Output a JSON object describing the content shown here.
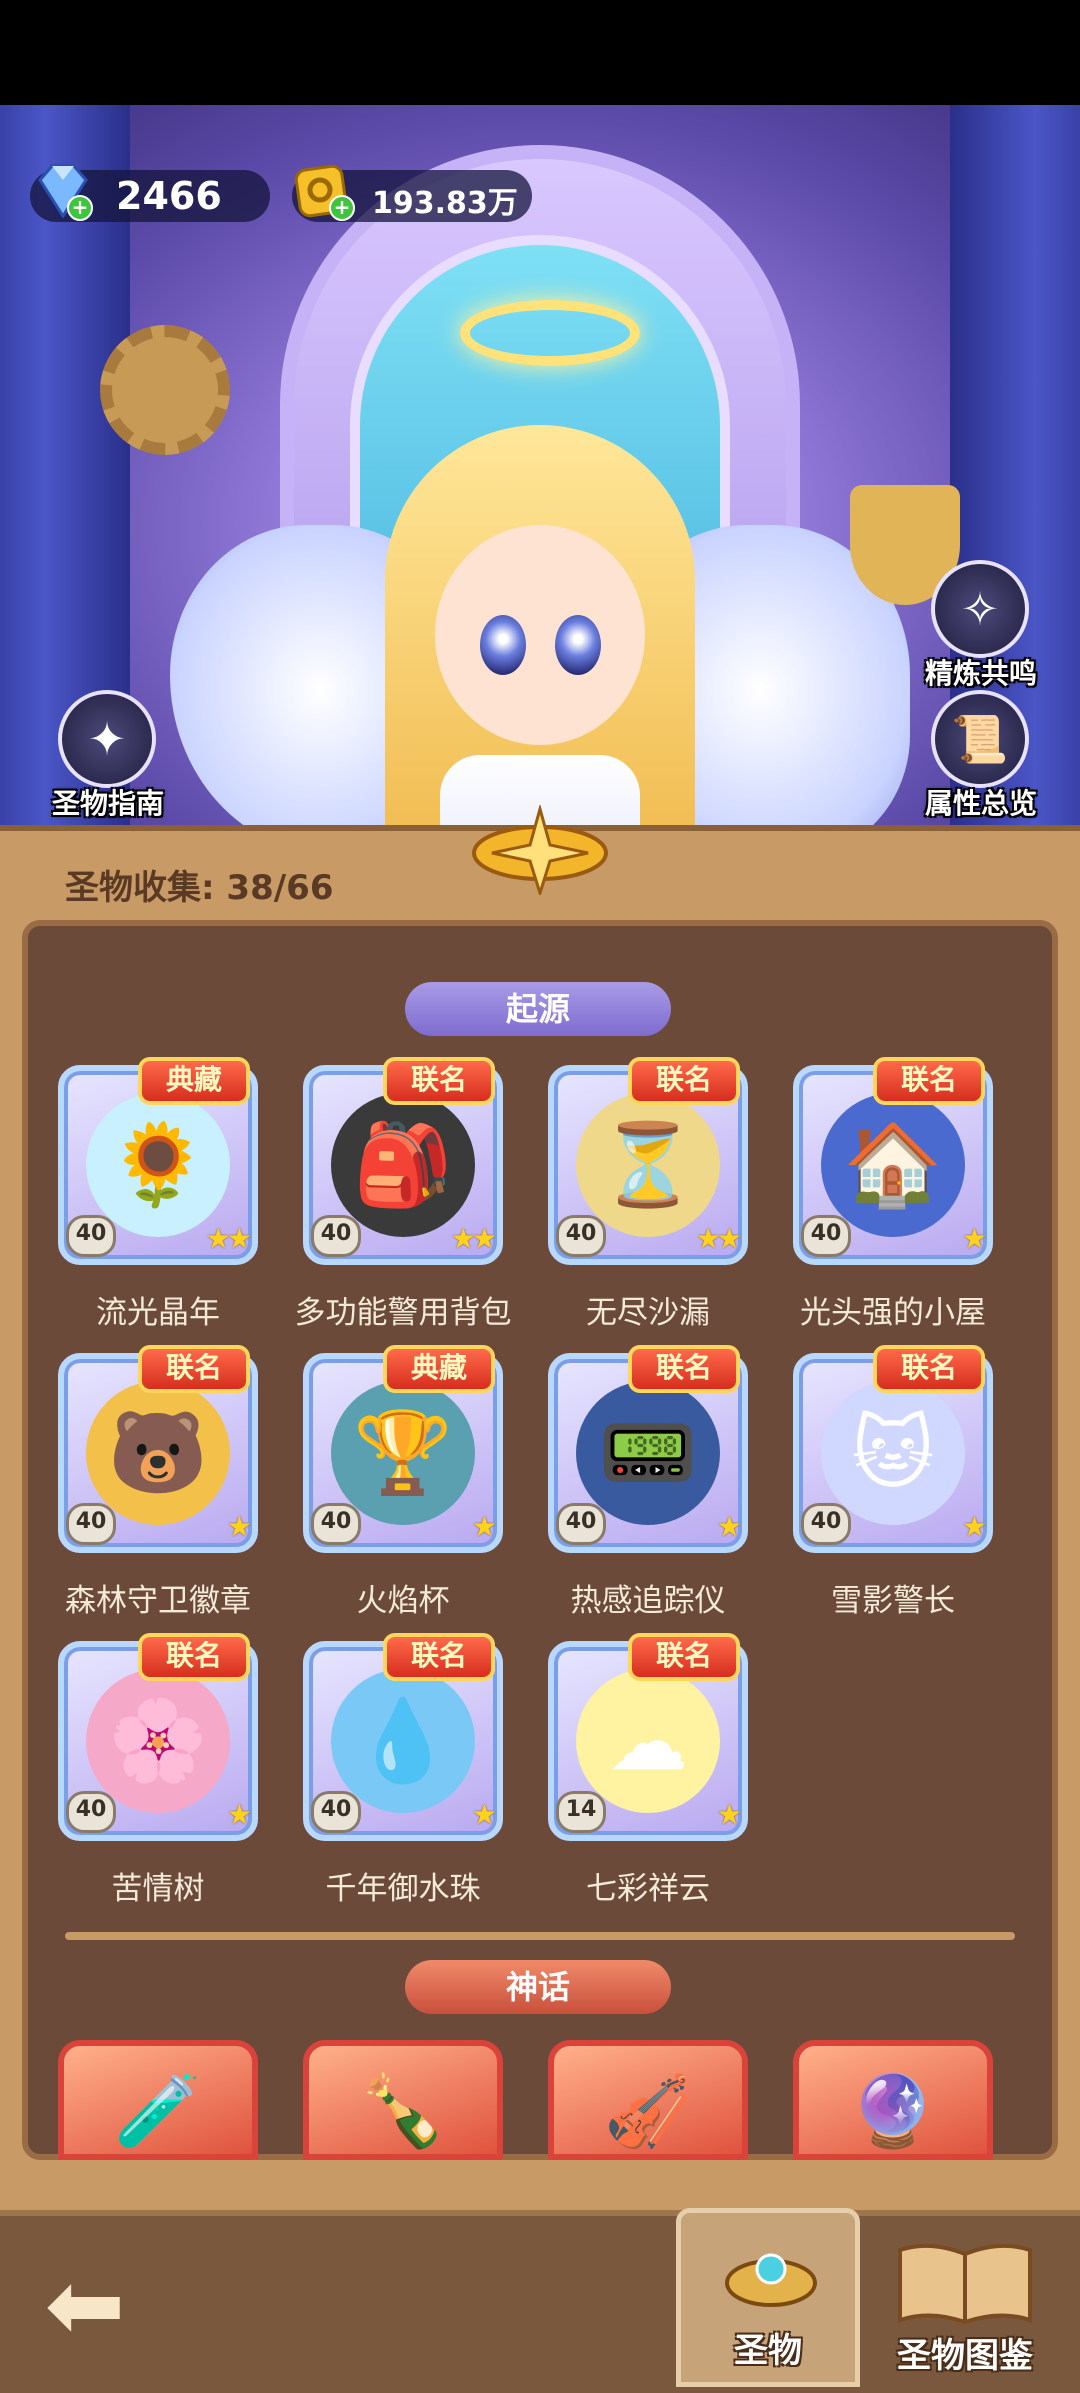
{
  "currency": {
    "gems": "2466",
    "coins": "193.83万"
  },
  "side_buttons": {
    "guide": "圣物指南",
    "resonance": "精炼共鸣",
    "attributes": "属性总览"
  },
  "collection": {
    "label": "圣物收集: 38/66"
  },
  "sections": {
    "origin": "起源",
    "myth": "神话"
  },
  "cards": [
    {
      "badge": "典藏",
      "level": "40",
      "stars": "★★",
      "name": "流光晶年",
      "icon": "🌻",
      "art_color": "#c9f0ff"
    },
    {
      "badge": "联名",
      "level": "40",
      "stars": "★★",
      "name": "多功能警用背包",
      "icon": "🎒",
      "art_color": "#3a3a3a"
    },
    {
      "badge": "联名",
      "level": "40",
      "stars": "★★",
      "name": "无尽沙漏",
      "icon": "⏳",
      "art_color": "#f0d88a"
    },
    {
      "badge": "联名",
      "level": "40",
      "stars": "★",
      "name": "光头强的小屋",
      "icon": "🏠",
      "art_color": "#4a6ad0"
    },
    {
      "badge": "联名",
      "level": "40",
      "stars": "★",
      "name": "森林守卫徽章",
      "icon": "🐻",
      "art_color": "#f3c04a"
    },
    {
      "badge": "典藏",
      "level": "40",
      "stars": "★",
      "name": "火焰杯",
      "icon": "🏆",
      "art_color": "#5aa0b0"
    },
    {
      "badge": "联名",
      "level": "40",
      "stars": "★",
      "name": "热感追踪仪",
      "icon": "📟",
      "art_color": "#3a5aa0"
    },
    {
      "badge": "联名",
      "level": "40",
      "stars": "★",
      "name": "雪影警长",
      "icon": "🐱",
      "art_color": "#d0d8ff"
    },
    {
      "badge": "联名",
      "level": "40",
      "stars": "★",
      "name": "苦情树",
      "icon": "🌸",
      "art_color": "#f5a8c8"
    },
    {
      "badge": "联名",
      "level": "40",
      "stars": "★",
      "name": "千年御水珠",
      "icon": "💧",
      "art_color": "#7ac8f5"
    },
    {
      "badge": "联名",
      "level": "14",
      "stars": "★",
      "name": "七彩祥云",
      "icon": "☁",
      "art_color": "#fff2a0"
    }
  ],
  "myth_cards": [
    {
      "icon": "🧪"
    },
    {
      "icon": "🍾"
    },
    {
      "icon": "🎻"
    },
    {
      "icon": "🔮"
    }
  ],
  "bottom_tabs": {
    "holy": "圣物",
    "codex": "圣物图鉴"
  }
}
